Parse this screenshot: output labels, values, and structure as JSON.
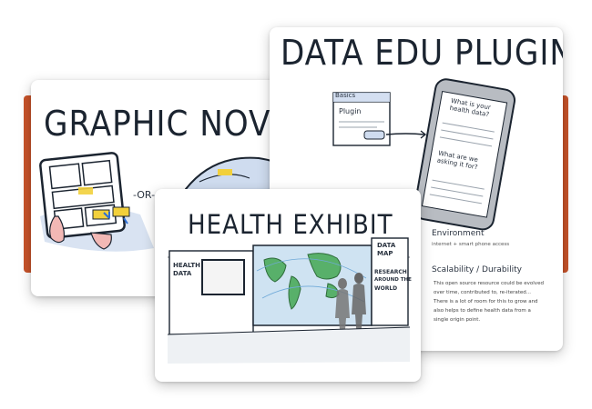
{
  "cards": {
    "graphic_novel": {
      "title": "GRAPHIC NOVEL",
      "or_label": "-OR-"
    },
    "data_edu": {
      "title": "DATA EDU PLUGIN",
      "window_tab": "Basics",
      "window_heading": "Plugin",
      "phone_q1": "What is your health data?",
      "phone_q2": "What are we asking it for?",
      "env_title": "Environment",
      "env_note": "internet + smart phone access",
      "scal_title": "Scalability / Durability",
      "scal_body": [
        "This open source resource could be evolved",
        "over time, contributed to, re-iterated...",
        "There is a lot of room for this to grow and",
        "also helps to define health data from a",
        "single origin point."
      ]
    },
    "health_exhibit": {
      "title": "HEALTH EXHIBIT",
      "left_label_1": "HEALTH",
      "left_label_2": "DATA",
      "right_label_1": "DATA",
      "right_label_2": "MAP",
      "right_label_3": "RESEARCH",
      "right_label_4": "AROUND THE",
      "right_label_5": "WORLD"
    }
  }
}
